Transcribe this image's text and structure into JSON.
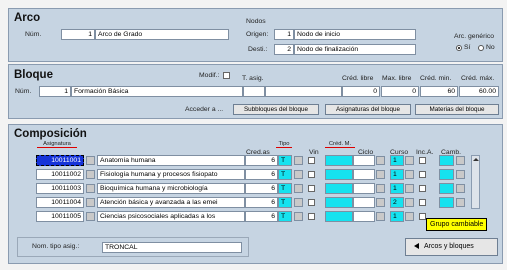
{
  "arco": {
    "title": "Arco",
    "num_label": "Núm.",
    "num_value": "1",
    "name_value": "Arco de Grado",
    "nodos_label": "Nodos",
    "origen_label": "Origen:",
    "origen_num": "1",
    "origen_name": "Nodo de inicio",
    "destino_label": "Desti.:",
    "destino_num": "2",
    "destino_name": "Nodo de finalización",
    "generico_label": "Arc. genérico",
    "si_label": "Sí",
    "no_label": "No",
    "generico_selected": "Sí"
  },
  "bloque": {
    "title": "Bloque",
    "modif_label": "Modif.:",
    "tasig_label": "T. asig.",
    "num_label": "Núm.",
    "num_value": "1",
    "name_value": "Formación Básica",
    "col_headers": [
      "Créd. libre",
      "Max. libre",
      "Créd. min.",
      "Créd. máx."
    ],
    "values": [
      "0",
      "0",
      "60",
      "60.00"
    ],
    "acceder_label": "Acceder a ...",
    "buttons": [
      "Subbloques del bloque",
      "Asignaturas del bloque",
      "Materias del bloque"
    ]
  },
  "composicion": {
    "title": "Composición",
    "headers": {
      "asignatura": "Asignatura",
      "cred": "Cred.as",
      "tipo": "Tipo",
      "vin": "Vin",
      "credm": "Créd. M.",
      "ciclo": "Ciclo",
      "curso": "Curso",
      "inca": "Inc.A.",
      "camb": "Camb."
    },
    "rows": [
      {
        "code": "10011001",
        "name": "Anatomía humana",
        "cred": "6",
        "tipo": "T",
        "curso": "1"
      },
      {
        "code": "10011002",
        "name": "Fisiología humana y procesos fisiopato",
        "cred": "6",
        "tipo": "T",
        "curso": "1"
      },
      {
        "code": "10011003",
        "name": "Bioquímica humana y microbiología",
        "cred": "6",
        "tipo": "T",
        "curso": "1"
      },
      {
        "code": "10011004",
        "name": "Atención básica y avanzada a las emei",
        "cred": "6",
        "tipo": "T",
        "curso": "2"
      },
      {
        "code": "10011005",
        "name": "Ciencias psicosociales aplicadas a los",
        "cred": "6",
        "tipo": "T",
        "curso": "1"
      }
    ],
    "tooltip": "Grupo cambiable",
    "nom_tipo_label": "Nom. tipo asig.:",
    "nom_tipo_value": "TRONCAL",
    "arcos_button": "Arcos y bloques"
  },
  "colors": {
    "panel": "#c6d4e2",
    "cyan": "#16e2ef",
    "selected": "#1633d8",
    "tooltip": "#ffff00",
    "underline": "#dd0000"
  }
}
